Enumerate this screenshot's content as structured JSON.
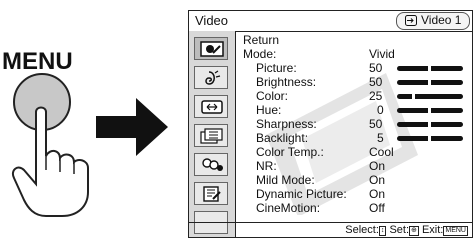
{
  "instruction": {
    "menu_button_label": "MENU"
  },
  "osd": {
    "title": "Video",
    "input_label": "Video 1",
    "sidebar": [
      {
        "icon": "picture-icon",
        "active": true
      },
      {
        "icon": "sound-icon",
        "active": false
      },
      {
        "icon": "screen-icon",
        "active": false
      },
      {
        "icon": "channel-icon",
        "active": false
      },
      {
        "icon": "parental-lock-icon",
        "active": false
      },
      {
        "icon": "setup-icon",
        "active": false
      },
      {
        "icon": "blank-icon",
        "active": false
      }
    ],
    "menu": {
      "return_label": "Return",
      "mode_label": "Mode:",
      "mode_value": "Vivid",
      "picture_label": "Picture:",
      "picture_value": "50",
      "brightness_label": "Brightness:",
      "brightness_value": "50",
      "color_label": "Color:",
      "color_value": "25",
      "hue_label": "Hue:",
      "hue_value": "0",
      "sharpness_label": "Sharpness:",
      "sharpness_value": "50",
      "backlight_label": "Backlight:",
      "backlight_value": "5",
      "color_temp_label": "Color Temp.:",
      "color_temp_value": "Cool",
      "nr_label": "NR:",
      "nr_value": "On",
      "mild_mode_label": "Mild Mode:",
      "mild_mode_value": "On",
      "dynamic_picture_label": "Dynamic Picture:",
      "dynamic_picture_value": "On",
      "cinemotion_label": "CineMotion:",
      "cinemotion_value": "Off"
    },
    "footer": {
      "select_text": "Select:",
      "select_key": "↕",
      "set_text": "Set:",
      "set_key": "⊕",
      "exit_text": "Exit:",
      "exit_key": "MENU"
    }
  }
}
